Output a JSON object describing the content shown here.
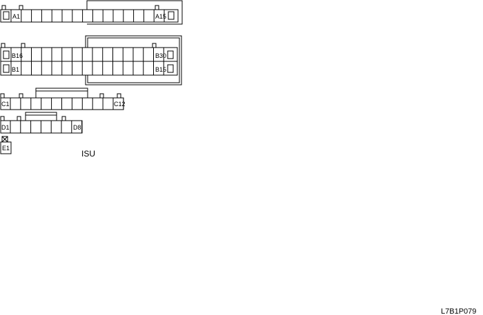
{
  "connectors": {
    "a": {
      "first_label": "A1",
      "last_label": "A15"
    },
    "b": {
      "top_first_label": "B16",
      "top_last_label": "B30",
      "bottom_first_label": "B1",
      "bottom_last_label": "B15"
    },
    "c": {
      "first_label": "C1",
      "last_label": "C12"
    },
    "d": {
      "first_label": "D1",
      "last_label": "D8"
    },
    "e": {
      "label": "E1"
    }
  },
  "caption": "ISU",
  "figure_code": "L7B1P079"
}
